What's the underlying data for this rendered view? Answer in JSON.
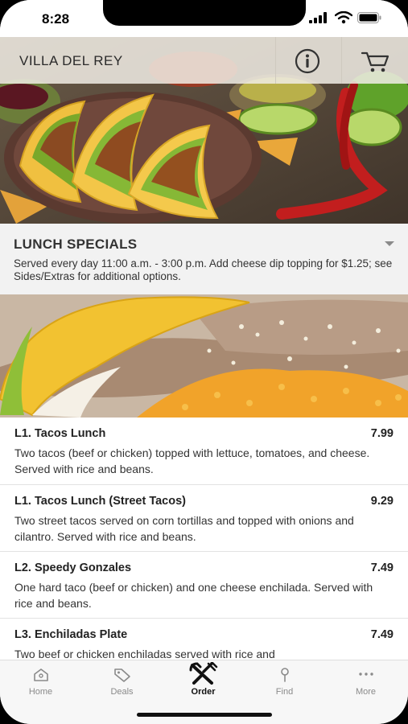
{
  "status": {
    "time": "8:28"
  },
  "header": {
    "brand": "VILLA DEL REY",
    "info_icon": "info-icon",
    "cart_icon": "cart-icon"
  },
  "section": {
    "title": "LUNCH SPECIALS",
    "description": "Served every day 11:00 a.m. - 3:00 p.m. Add cheese dip topping for $1.25; see Sides/Extras for additional options."
  },
  "menu": {
    "items": [
      {
        "name": "L1. Tacos Lunch",
        "price": "7.99",
        "description": "Two tacos (beef or chicken) topped with lettuce, tomatoes, and cheese. Served with rice and beans."
      },
      {
        "name": "L1. Tacos Lunch (Street Tacos)",
        "price": "9.29",
        "description": "Two street tacos served on corn tortillas and topped with onions and cilantro. Served with rice and beans."
      },
      {
        "name": "L2. Speedy Gonzales",
        "price": "7.49",
        "description": "One hard taco (beef or chicken) and one cheese enchilada. Served with rice and beans."
      },
      {
        "name": "L3. Enchiladas Plate",
        "price": "7.49",
        "description": "Two beef or chicken enchiladas served with rice and"
      }
    ]
  },
  "tabs": [
    {
      "label": "Home",
      "icon": "home-icon",
      "active": false
    },
    {
      "label": "Deals",
      "icon": "tag-icon",
      "active": false
    },
    {
      "label": "Order",
      "icon": "utensils-icon",
      "active": true
    },
    {
      "label": "Find",
      "icon": "pin-icon",
      "active": false
    },
    {
      "label": "More",
      "icon": "more-icon",
      "active": false
    }
  ]
}
